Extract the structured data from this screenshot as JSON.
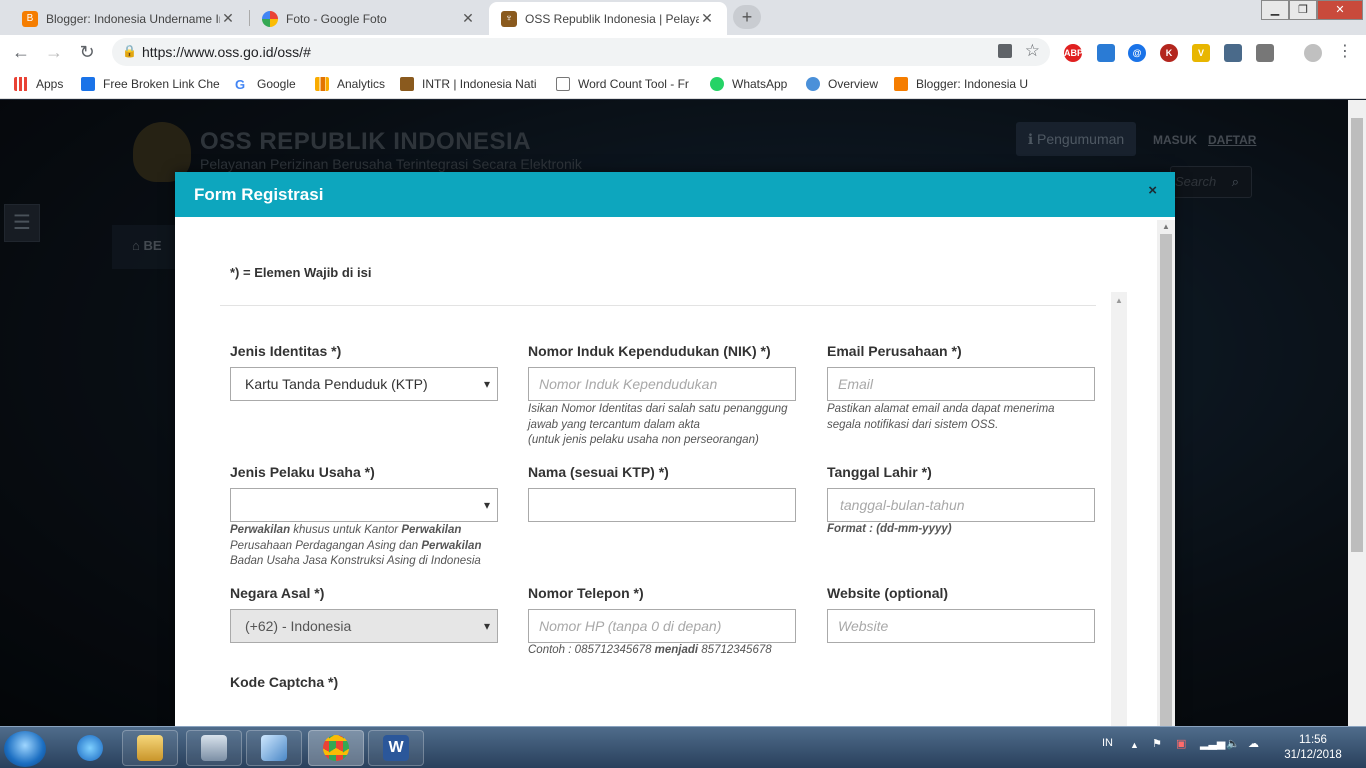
{
  "browser": {
    "tabs": [
      {
        "title": "Blogger: Indonesia Undername In",
        "icon": "blogger-icon",
        "color": "#f57d00"
      },
      {
        "title": "Foto - Google Foto",
        "icon": "google-photos-icon",
        "color": "#f4b400"
      },
      {
        "title": "OSS Republik Indonesia | Pelayan",
        "icon": "garuda-icon",
        "color": "#8a5a1e"
      }
    ],
    "new_tab": "+",
    "url": "https://www.oss.go.id/oss/#",
    "window_controls": {
      "minimize": "▁",
      "maximize": "❐",
      "close": "✕"
    },
    "extensions": [
      "ABP",
      "@",
      "K",
      "V"
    ],
    "bookmarks": [
      {
        "label": "Apps",
        "icon": "apps-grid-icon",
        "color": "#e94235"
      },
      {
        "label": "Free Broken Link Che",
        "icon": "checkmark-icon",
        "color": "#1a73e8"
      },
      {
        "label": "Google",
        "icon": "google-icon",
        "color": "#4285f4"
      },
      {
        "label": "Analytics",
        "icon": "analytics-icon",
        "color": "#f9ab00"
      },
      {
        "label": "INTR | Indonesia Nati",
        "icon": "garuda-icon",
        "color": "#8a5a1e"
      },
      {
        "label": "Word Count Tool - Fr",
        "icon": "page-icon",
        "color": "#ffffff"
      },
      {
        "label": "WhatsApp",
        "icon": "whatsapp-icon",
        "color": "#25d366"
      },
      {
        "label": "Overview",
        "icon": "overview-icon",
        "color": "#4a90d9"
      },
      {
        "label": "Blogger: Indonesia U",
        "icon": "blogger-icon",
        "color": "#f57d00"
      }
    ]
  },
  "site": {
    "title": "OSS REPUBLIK INDONESIA",
    "subtitle": "Pelayanan Perizinan Berusaha Terintegrasi Secara Elektronik",
    "announcement": "ℹ Pengumuman",
    "login": "MASUK",
    "register": "DAFTAR",
    "nav_home": "BE",
    "search_placeholder": "Search"
  },
  "modal": {
    "title": "Form Registrasi",
    "close": "×",
    "required_note": "*) = Elemen Wajib di isi",
    "fields": {
      "jenis_identitas": {
        "label": "Jenis Identitas *)",
        "value": "Kartu Tanda Penduduk (KTP)"
      },
      "nik": {
        "label": "Nomor Induk Kependudukan (NIK) *)",
        "placeholder": "Nomor Induk Kependudukan",
        "help": [
          "Isikan Nomor Identitas dari salah satu penanggung",
          "jawab yang tercantum dalam akta",
          "(untuk jenis pelaku usaha non perseorangan)"
        ]
      },
      "email": {
        "label": "Email Perusahaan *)",
        "placeholder": "Email",
        "help": [
          "Pastikan alamat email anda dapat menerima",
          "segala notifikasi dari sistem OSS."
        ]
      },
      "jenis_pelaku": {
        "label": "Jenis Pelaku Usaha *)",
        "value": "",
        "help_parts": {
          "b1": "Perwakilan",
          "t1": " khusus untuk Kantor ",
          "b2": "Perwakilan",
          "line2a": "Perusahaan Perdagangan Asing dan ",
          "b3": "Perwakilan",
          "line3": "Badan Usaha Jasa Konstruksi Asing di Indonesia"
        }
      },
      "nama": {
        "label": "Nama (sesuai KTP) *)",
        "value": ""
      },
      "tanggal_lahir": {
        "label": "Tanggal Lahir *)",
        "placeholder": "tanggal-bulan-tahun",
        "help": "Format : (dd-mm-yyyy)"
      },
      "negara_asal": {
        "label": "Negara Asal *)",
        "value": "(+62) - Indonesia"
      },
      "telepon": {
        "label": "Nomor Telepon *)",
        "placeholder": "Nomor HP (tanpa 0 di depan)",
        "help_a": "Contoh : 085712345678 ",
        "help_b": "menjadi",
        "help_c": " 85712345678"
      },
      "website": {
        "label": "Website (optional)",
        "placeholder": "Website"
      },
      "captcha": {
        "label": "Kode Captcha *)"
      }
    }
  },
  "taskbar": {
    "language": "IN",
    "time": "11:56",
    "date": "31/12/2018"
  }
}
